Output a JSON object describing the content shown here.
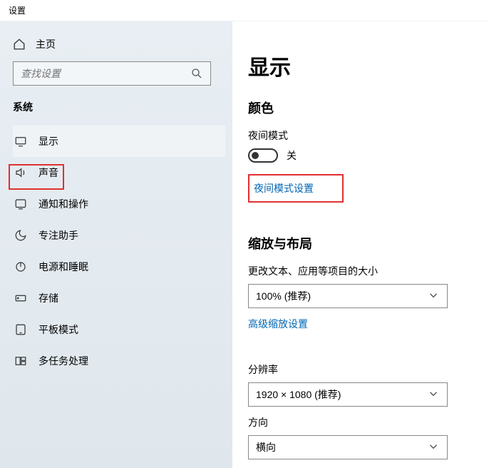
{
  "window": {
    "title": "设置"
  },
  "sidebar": {
    "home": "主页",
    "search_placeholder": "查找设置",
    "section": "系统",
    "items": [
      {
        "label": "显示"
      },
      {
        "label": "声音"
      },
      {
        "label": "通知和操作"
      },
      {
        "label": "专注助手"
      },
      {
        "label": "电源和睡眠"
      },
      {
        "label": "存储"
      },
      {
        "label": "平板模式"
      },
      {
        "label": "多任务处理"
      }
    ]
  },
  "content": {
    "title": "显示",
    "color_header": "颜色",
    "night_mode_label": "夜间模式",
    "night_mode_state": "关",
    "night_mode_link": "夜间模式设置",
    "scale_header": "缩放与布局",
    "scale_label": "更改文本、应用等项目的大小",
    "scale_value": "100% (推荐)",
    "advanced_scale_link": "高级缩放设置",
    "resolution_label": "分辨率",
    "resolution_value": "1920 × 1080 (推荐)",
    "orientation_label": "方向",
    "orientation_value": "横向"
  }
}
